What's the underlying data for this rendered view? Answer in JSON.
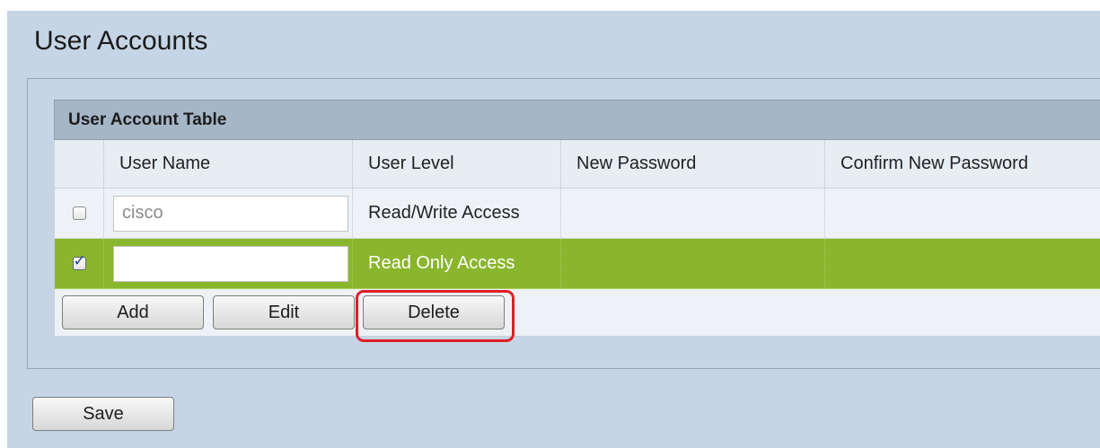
{
  "page": {
    "title": "User Accounts"
  },
  "table": {
    "caption": "User Account Table",
    "columns": [
      "",
      "User Name",
      "User Level",
      "New Password",
      "Confirm New Password"
    ],
    "rows": [
      {
        "checked": false,
        "user_name": "cisco",
        "user_level": "Read/Write Access",
        "new_password": "",
        "confirm_password": ""
      },
      {
        "checked": true,
        "user_name": "",
        "user_level": "Read Only Access",
        "new_password": "",
        "confirm_password": ""
      }
    ]
  },
  "actions": {
    "add_label": "Add",
    "edit_label": "Edit",
    "delete_label": "Delete"
  },
  "footer": {
    "save_label": "Save"
  },
  "colors": {
    "page_background": "#c5d5e5",
    "selected_row": "#8ab62e",
    "highlight_outline": "#e01e26"
  }
}
